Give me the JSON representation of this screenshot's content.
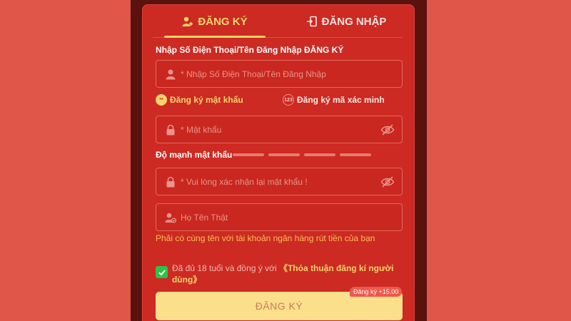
{
  "tabs": {
    "register_label": "ĐĂNG KÝ",
    "login_label": "ĐĂNG NHẬP"
  },
  "form": {
    "section_label": "Nhập Số Điện Thoại/Tên Đăng Nhập ĐĂNG KÝ",
    "username_placeholder": "* Nhập Số Điện Thoại/Tên Đăng Nhập",
    "mode_password_label": "Đăng ký mật khẩu",
    "mode_password_badge": "**",
    "mode_otp_label": "Đăng ký mã xác minh",
    "mode_otp_badge": "123",
    "password_placeholder": "* Mật khẩu",
    "strength_label": "Độ mạnh mật khẩu",
    "confirm_placeholder": "* Vui lòng xác nhận lại mật khẩu !",
    "realname_placeholder": "Họ Tên Thật",
    "realname_hint": "Phải có cùng tên với tài khoản ngân hàng rút tiền của bạn",
    "agree_text": "Đã đủ 18 tuổi và đồng ý với",
    "agree_link": "《Thỏa thuận đăng kí người dùng》",
    "agree_checked": true,
    "bonus_badge": "Đăng ký +15.00",
    "submit_label": "ĐĂNG KÝ"
  },
  "colors": {
    "page_background": "#e0574a",
    "modal_background": "#cc2a22",
    "accent": "#f6d46b",
    "checkbox": "#2fc24a",
    "submit_background": "#fbdf8b"
  },
  "icons": {
    "register_tab": "add-user-icon",
    "login_tab": "login-door-icon",
    "username": "user-icon",
    "password": "lock-icon",
    "confirm": "lock-icon",
    "realname": "user-check-icon",
    "visibility": "eye-off-icon"
  }
}
